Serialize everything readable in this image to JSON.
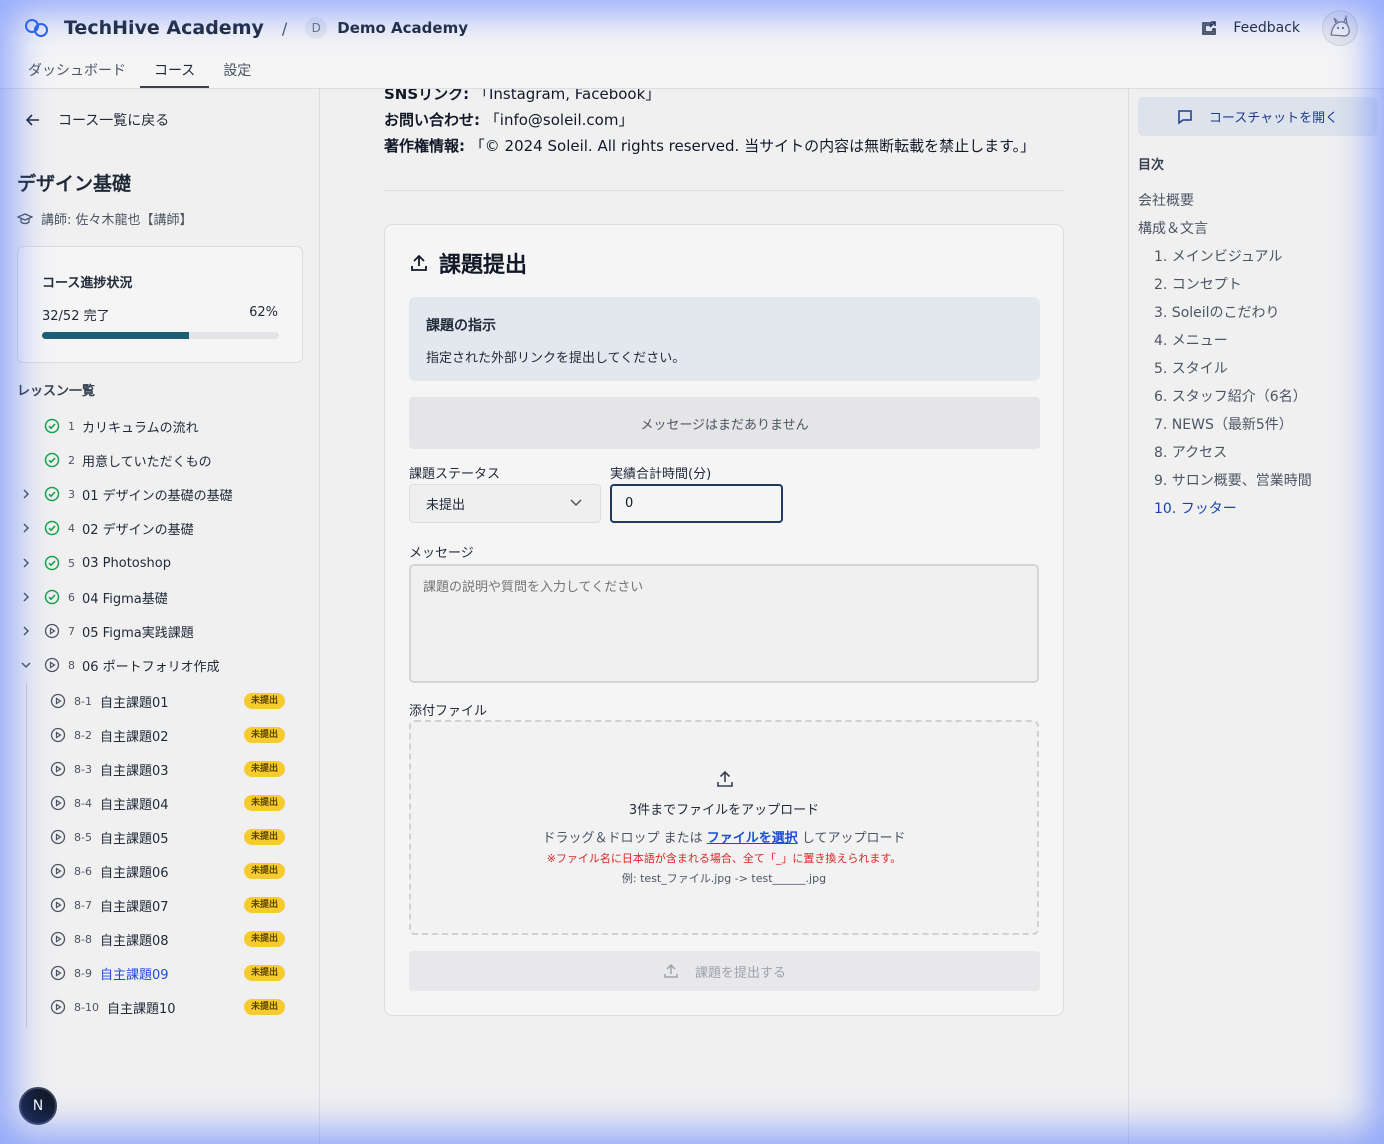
{
  "header": {
    "brand": "TechHive Academy",
    "separator": "/",
    "org_initial": "D",
    "org_name": "Demo Academy",
    "feedback_label": "Feedback",
    "tabs": [
      {
        "label": "ダッシュボード"
      },
      {
        "label": "コース"
      },
      {
        "label": "設定"
      }
    ],
    "active_tab": "コース"
  },
  "sidebar": {
    "back_label": "コース一覧に戻る",
    "course_title": "デザイン基礎",
    "instructor": "講師: 佐々木龍也【講師】",
    "progress": {
      "title": "コース進捗状況",
      "count_text": "32/52 完了",
      "percent_text": "62%",
      "percent": 62
    },
    "lessons_title": "レッスン一覧",
    "lessons": [
      {
        "num": "1",
        "title": "カリキュラムの流れ",
        "status": "done",
        "expandable": false
      },
      {
        "num": "2",
        "title": "用意していただくもの",
        "status": "done",
        "expandable": false
      },
      {
        "num": "3",
        "title": "01 デザインの基礎の基礎",
        "status": "done",
        "expandable": true
      },
      {
        "num": "4",
        "title": "02 デザインの基礎",
        "status": "done",
        "expandable": true
      },
      {
        "num": "5",
        "title": "03 Photoshop",
        "status": "done",
        "expandable": true
      },
      {
        "num": "6",
        "title": "04 Figma基礎",
        "status": "done",
        "expandable": true
      },
      {
        "num": "7",
        "title": "05 Figma実践課題",
        "status": "play",
        "expandable": true
      },
      {
        "num": "8",
        "title": "06 ポートフォリオ作成",
        "status": "play",
        "expandable": true,
        "expanded": true
      }
    ],
    "sublessons": [
      {
        "num": "8-1",
        "title": "自主課題01",
        "badge": "未提出"
      },
      {
        "num": "8-2",
        "title": "自主課題02",
        "badge": "未提出"
      },
      {
        "num": "8-3",
        "title": "自主課題03",
        "badge": "未提出"
      },
      {
        "num": "8-4",
        "title": "自主課題04",
        "badge": "未提出"
      },
      {
        "num": "8-5",
        "title": "自主課題05",
        "badge": "未提出"
      },
      {
        "num": "8-6",
        "title": "自主課題06",
        "badge": "未提出"
      },
      {
        "num": "8-7",
        "title": "自主課題07",
        "badge": "未提出"
      },
      {
        "num": "8-8",
        "title": "自主課題08",
        "badge": "未提出"
      },
      {
        "num": "8-9",
        "title": "自主課題09",
        "badge": "未提出",
        "current": true
      },
      {
        "num": "8-10",
        "title": "自主課題10",
        "badge": "未提出"
      }
    ],
    "bottom_badge": "N"
  },
  "main": {
    "info": [
      {
        "label": "SNSリンク:",
        "value": "「Instagram, Facebook」"
      },
      {
        "label": "お問い合わせ:",
        "value": "「info@soleil.com」"
      },
      {
        "label": "著作権情報:",
        "value": "「© 2024 Soleil. All rights reserved. 当サイトの内容は無断転載を禁止します。」"
      }
    ],
    "card_title": "課題提出",
    "instruction_title": "課題の指示",
    "instruction_body": "指定された外部リンクを提出してください。",
    "no_messages": "メッセージはまだありません",
    "status_label": "課題ステータス",
    "status_value": "未提出",
    "time_label": "実績合計時間(分)",
    "time_value": "0",
    "message_label": "メッセージ",
    "message_placeholder": "課題の説明や質問を入力してください",
    "attachment_label": "添付ファイル",
    "dropzone": {
      "line1": "3件までファイルをアップロード",
      "before_link": "ドラッグ＆ドロップ または ",
      "link": "ファイルを選択",
      "after_link": " してアップロード",
      "warning": "※ファイル名に日本語が含まれる場合、全て「_」に置き換えられます。",
      "example": "例: test_ファイル.jpg -> test______.jpg"
    },
    "submit_label": "課題を提出する"
  },
  "toc": {
    "chat_label": "コースチャットを開く",
    "title": "目次",
    "items": [
      {
        "label": "会社概要",
        "level": "top"
      },
      {
        "label": "構成＆文言",
        "level": "top"
      },
      {
        "label": "1. メインビジュアル",
        "level": "sub"
      },
      {
        "label": "2. コンセプト",
        "level": "sub"
      },
      {
        "label": "3. Soleilのこだわり",
        "level": "sub"
      },
      {
        "label": "4. メニュー",
        "level": "sub"
      },
      {
        "label": "5. スタイル",
        "level": "sub"
      },
      {
        "label": "6. スタッフ紹介（6名）",
        "level": "sub"
      },
      {
        "label": "7. NEWS（最新5件）",
        "level": "sub"
      },
      {
        "label": "8. アクセス",
        "level": "sub"
      },
      {
        "label": "9. サロン概要、営業時間",
        "level": "sub"
      },
      {
        "label": "10. フッター",
        "level": "sub",
        "active": true
      }
    ]
  },
  "colors": {
    "progress_fill": "#1e5e75",
    "done_icon": "#16a34a",
    "badge_bg": "#f5cb2e",
    "link_blue": "#1d4ed8",
    "warning_red": "#dc2626",
    "vignette": "#466eff"
  }
}
